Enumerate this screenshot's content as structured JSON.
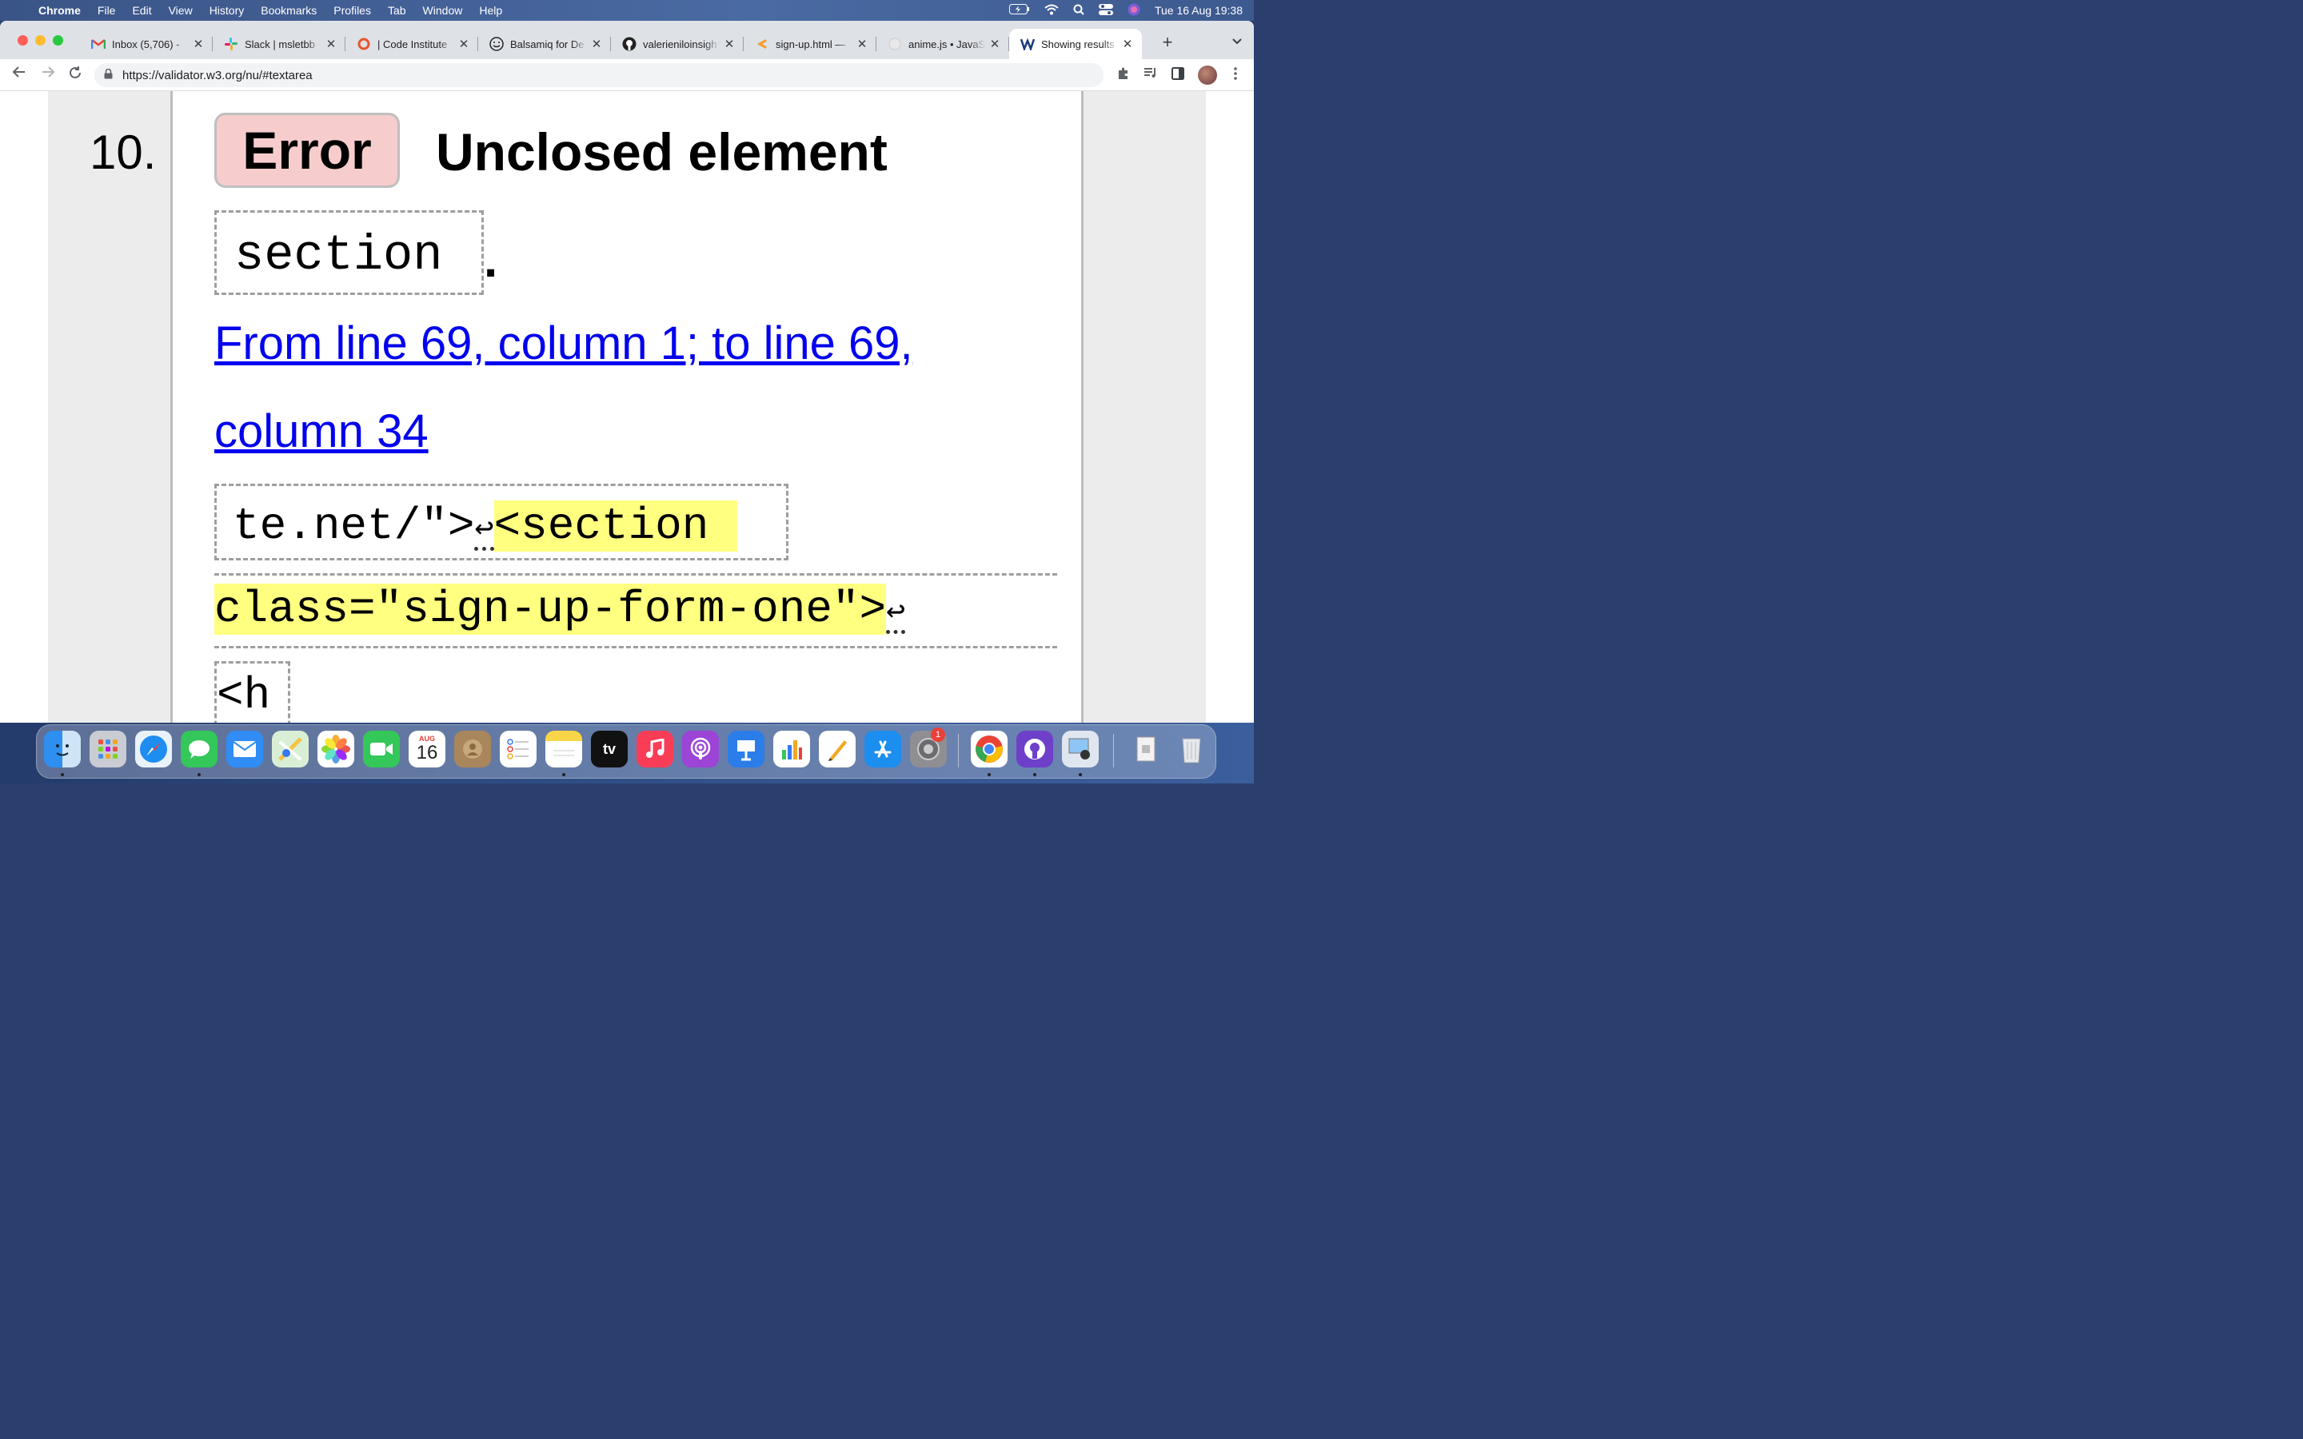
{
  "menubar": {
    "app": "Chrome",
    "items": [
      "File",
      "Edit",
      "View",
      "History",
      "Bookmarks",
      "Profiles",
      "Tab",
      "Window",
      "Help"
    ],
    "datetime": "Tue 16 Aug  19:38"
  },
  "tabs": [
    {
      "label": "Inbox (5,706) -",
      "icon": "gmail-icon"
    },
    {
      "label": "Slack | msletbb",
      "icon": "slack-icon"
    },
    {
      "label": "| Code Institute",
      "icon": "code-institute-icon"
    },
    {
      "label": "Balsamiq for De",
      "icon": "balsamiq-icon"
    },
    {
      "label": "valerieniloinsigh",
      "icon": "github-icon"
    },
    {
      "label": "sign-up.html —",
      "icon": "gitpod-icon"
    },
    {
      "label": "anime.js • JavaS",
      "icon": "anime-icon"
    },
    {
      "label": "Showing results",
      "icon": "w3c-icon"
    }
  ],
  "address_bar": {
    "url": "https://validator.w3.org/nu/#textarea"
  },
  "message": {
    "number": "10.",
    "badge": "Error",
    "title": "Unclosed element",
    "element": "section",
    "period": ".",
    "location_line1": "From line 69, column 1; to line 69,",
    "location_line2": "column 34",
    "extract_pre": "te.net/\">",
    "extract_return": "↩",
    "extract_hl1": "<section",
    "extract_hl2": "class=\"sign-up-form-one\">",
    "extract_return2": "↩",
    "extract_next": "<h"
  },
  "dock": {
    "calendar_month": "AUG",
    "calendar_day": "16",
    "settings_badge": "1",
    "tv_label": "tv"
  }
}
